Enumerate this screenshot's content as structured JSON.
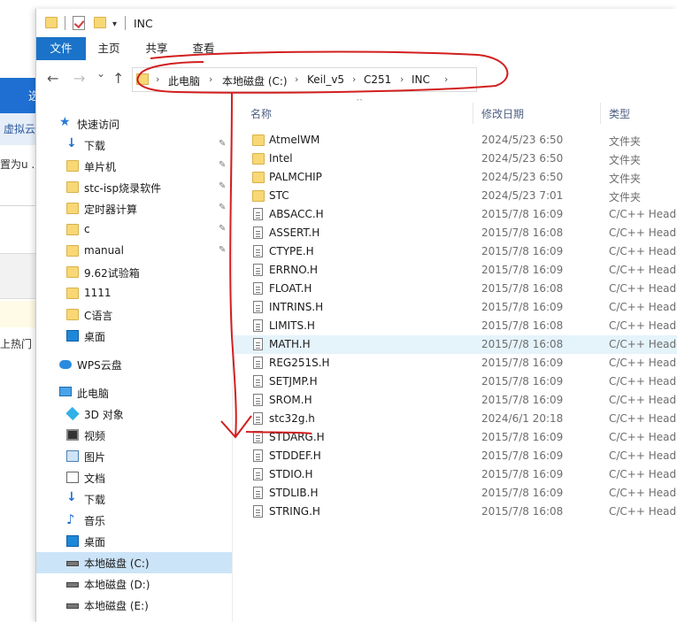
{
  "background_app": {
    "blue_bar_text": "选",
    "light_bar_text": "虚拟云",
    "snippet_text": "置为u ...",
    "snippet2_text": "上热门"
  },
  "window": {
    "title": "INC",
    "quick_access_dropdown": "▾"
  },
  "ribbon": {
    "tabs": [
      "文件",
      "主页",
      "共享",
      "查看"
    ]
  },
  "nav": {
    "back": "←",
    "forward": "→",
    "recent": "⌄",
    "up": "↑",
    "breadcrumb": [
      "此电脑",
      "本地磁盘 (C:)",
      "Keil_v5",
      "C251",
      "INC"
    ],
    "separator": "›"
  },
  "sidebar": {
    "items": [
      {
        "label": "快速访问",
        "icon": "star-icon"
      },
      {
        "label": "下载",
        "icon": "download-icon",
        "pinned": true
      },
      {
        "label": "单片机",
        "icon": "folder-icon",
        "pinned": true
      },
      {
        "label": "stc-isp烧录软件",
        "icon": "folder-icon",
        "pinned": true
      },
      {
        "label": "定时器计算",
        "icon": "folder-icon",
        "pinned": true
      },
      {
        "label": "c",
        "icon": "folder-icon",
        "pinned": true
      },
      {
        "label": "manual",
        "icon": "folder-icon",
        "pinned": true
      },
      {
        "label": "9.62试验箱",
        "icon": "folder-icon"
      },
      {
        "label": "1111",
        "icon": "folder-icon"
      },
      {
        "label": "C语言",
        "icon": "folder-icon"
      },
      {
        "label": "桌面",
        "icon": "desktop-icon"
      },
      {
        "label": "WPS云盘",
        "icon": "cloud-icon"
      },
      {
        "label": "此电脑",
        "icon": "computer-icon"
      },
      {
        "label": "3D 对象",
        "icon": "3d-objects-icon"
      },
      {
        "label": "视频",
        "icon": "video-icon"
      },
      {
        "label": "图片",
        "icon": "pictures-icon"
      },
      {
        "label": "文档",
        "icon": "documents-icon"
      },
      {
        "label": "下载",
        "icon": "download-icon"
      },
      {
        "label": "音乐",
        "icon": "music-icon"
      },
      {
        "label": "桌面",
        "icon": "desktop-icon"
      },
      {
        "label": "本地磁盘 (C:)",
        "icon": "drive-icon",
        "selected": true
      },
      {
        "label": "本地磁盘 (D:)",
        "icon": "drive-icon"
      },
      {
        "label": "本地磁盘 (E:)",
        "icon": "drive-icon"
      }
    ],
    "pin_glyph": "📌"
  },
  "filelist": {
    "columns": [
      "名称",
      "修改日期",
      "类型"
    ],
    "sort_arrow": "^",
    "rows": [
      {
        "name": "AtmelWM",
        "date": "2024/5/23 6:50",
        "type": "文件夹",
        "kind": "folder"
      },
      {
        "name": "Intel",
        "date": "2024/5/23 6:50",
        "type": "文件夹",
        "kind": "folder"
      },
      {
        "name": "PALMCHIP",
        "date": "2024/5/23 6:50",
        "type": "文件夹",
        "kind": "folder"
      },
      {
        "name": "STC",
        "date": "2024/5/23 7:01",
        "type": "文件夹",
        "kind": "folder"
      },
      {
        "name": "ABSACC.H",
        "date": "2015/7/8 16:09",
        "type": "C/C++ Header",
        "kind": "file"
      },
      {
        "name": "ASSERT.H",
        "date": "2015/7/8 16:08",
        "type": "C/C++ Header",
        "kind": "file"
      },
      {
        "name": "CTYPE.H",
        "date": "2015/7/8 16:09",
        "type": "C/C++ Header",
        "kind": "file"
      },
      {
        "name": "ERRNO.H",
        "date": "2015/7/8 16:09",
        "type": "C/C++ Header",
        "kind": "file"
      },
      {
        "name": "FLOAT.H",
        "date": "2015/7/8 16:08",
        "type": "C/C++ Header",
        "kind": "file"
      },
      {
        "name": "INTRINS.H",
        "date": "2015/7/8 16:09",
        "type": "C/C++ Header",
        "kind": "file"
      },
      {
        "name": "LIMITS.H",
        "date": "2015/7/8 16:08",
        "type": "C/C++ Header",
        "kind": "file"
      },
      {
        "name": "MATH.H",
        "date": "2015/7/8 16:08",
        "type": "C/C++ Header",
        "kind": "file",
        "hover": true
      },
      {
        "name": "REG251S.H",
        "date": "2015/7/8 16:09",
        "type": "C/C++ Header",
        "kind": "file"
      },
      {
        "name": "SETJMP.H",
        "date": "2015/7/8 16:09",
        "type": "C/C++ Header",
        "kind": "file"
      },
      {
        "name": "SROM.H",
        "date": "2015/7/8 16:09",
        "type": "C/C++ Header",
        "kind": "file"
      },
      {
        "name": "stc32g.h",
        "date": "2024/6/1 20:18",
        "type": "C/C++ Header",
        "kind": "file"
      },
      {
        "name": "STDARG.H",
        "date": "2015/7/8 16:09",
        "type": "C/C++ Header",
        "kind": "file"
      },
      {
        "name": "STDDEF.H",
        "date": "2015/7/8 16:09",
        "type": "C/C++ Header",
        "kind": "file"
      },
      {
        "name": "STDIO.H",
        "date": "2015/7/8 16:09",
        "type": "C/C++ Header",
        "kind": "file"
      },
      {
        "name": "STDLIB.H",
        "date": "2015/7/8 16:09",
        "type": "C/C++ Header",
        "kind": "file"
      },
      {
        "name": "STRING.H",
        "date": "2015/7/8 16:08",
        "type": "C/C++ Header",
        "kind": "file"
      }
    ]
  },
  "colors": {
    "accent": "#1a73c8",
    "selected": "#cce4f7",
    "hover": "#e5f3fb",
    "annotation": "#d21f1f"
  }
}
